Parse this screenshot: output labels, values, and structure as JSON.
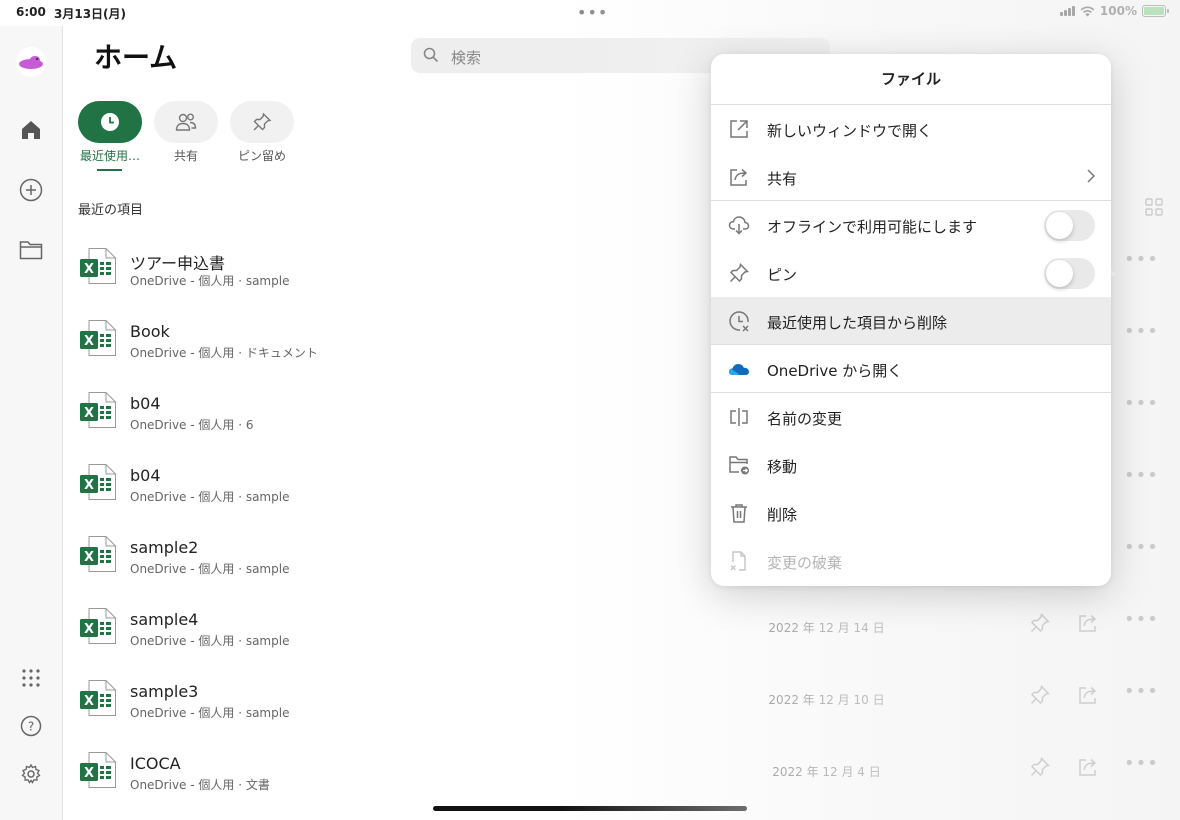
{
  "status": {
    "time": "6:00",
    "date": "3月13日(月)",
    "battery": "100%"
  },
  "page": {
    "title": "ホーム"
  },
  "search": {
    "placeholder": "検索"
  },
  "filters": [
    {
      "label": "最近使用…",
      "active": true
    },
    {
      "label": "共有",
      "active": false
    },
    {
      "label": "ピン留め",
      "active": false
    }
  ],
  "section": {
    "label": "最近の項目"
  },
  "files": [
    {
      "name": "ツアー申込書",
      "location": "OneDrive - 個人用 · sample",
      "date": ""
    },
    {
      "name": "Book",
      "location": "OneDrive - 個人用 · ドキュメント",
      "date": ""
    },
    {
      "name": "b04",
      "location": "OneDrive - 個人用 · 6",
      "date": ""
    },
    {
      "name": "b04",
      "location": "OneDrive - 個人用 · sample",
      "date": ""
    },
    {
      "name": "sample2",
      "location": "OneDrive - 個人用 · sample",
      "date": ""
    },
    {
      "name": "sample4",
      "location": "OneDrive - 個人用 · sample",
      "date": "2022 年 12 月 14 日"
    },
    {
      "name": "sample3",
      "location": "OneDrive - 個人用 · sample",
      "date": "2022 年 12 月 10 日"
    },
    {
      "name": "ICOCA",
      "location": "OneDrive - 個人用 · 文書",
      "date": "2022 年 12 月 4 日"
    }
  ],
  "popover": {
    "title": "ファイル",
    "items": [
      {
        "label": "新しいウィンドウで開く",
        "icon": "open-external-icon"
      },
      {
        "label": "共有",
        "icon": "share-icon"
      },
      {
        "label": "オフラインで利用可能にします",
        "icon": "cloud-download-icon",
        "toggle": false
      },
      {
        "label": "ピン",
        "icon": "pin-icon",
        "toggle": false
      },
      {
        "label": "最近使用した項目から削除",
        "icon": "clock-remove-icon"
      },
      {
        "label": "OneDrive から開く",
        "icon": "onedrive-icon"
      },
      {
        "label": "名前の変更",
        "icon": "rename-icon"
      },
      {
        "label": "移動",
        "icon": "move-folder-icon"
      },
      {
        "label": "削除",
        "icon": "trash-icon"
      },
      {
        "label": "変更の破棄",
        "icon": "discard-icon",
        "disabled": true
      }
    ]
  },
  "colors": {
    "accent": "#217346",
    "onedrive": "#0f6cbd"
  }
}
